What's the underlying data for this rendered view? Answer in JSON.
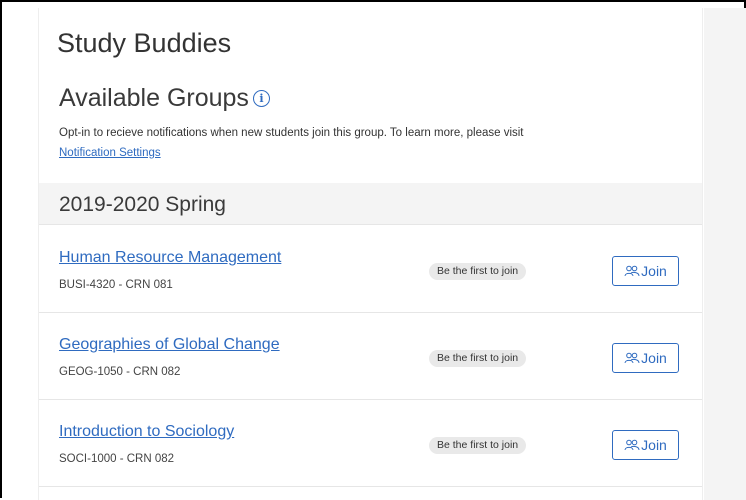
{
  "header": {
    "app_title": "Study Buddies",
    "section_title": "Available Groups",
    "info_glyph": "i"
  },
  "notice": {
    "text": "Opt-in to recieve notifications when new students join this group. To learn more, please visit",
    "link_label": "Notification Settings"
  },
  "term": {
    "title": "2019-2020 Spring"
  },
  "groups": [
    {
      "course_name": "Human Resource Management",
      "course_meta": "BUSI-4320 - CRN 081",
      "badge": "Be the first to join",
      "join_label": "Join"
    },
    {
      "course_name": "Geographies of Global Change",
      "course_meta": "GEOG-1050 - CRN 082",
      "badge": "Be the first to join",
      "join_label": "Join"
    },
    {
      "course_name": "Introduction to Sociology",
      "course_meta": "SOCI-1000 - CRN 082",
      "badge": "Be the first to join",
      "join_label": "Join"
    }
  ],
  "colors": {
    "link_blue": "#2f6bc0",
    "term_bar_bg": "#f4f4f4",
    "badge_bg": "#e9e9e9"
  },
  "icons": {
    "info": "info-circle-icon",
    "join": "users-icon"
  }
}
